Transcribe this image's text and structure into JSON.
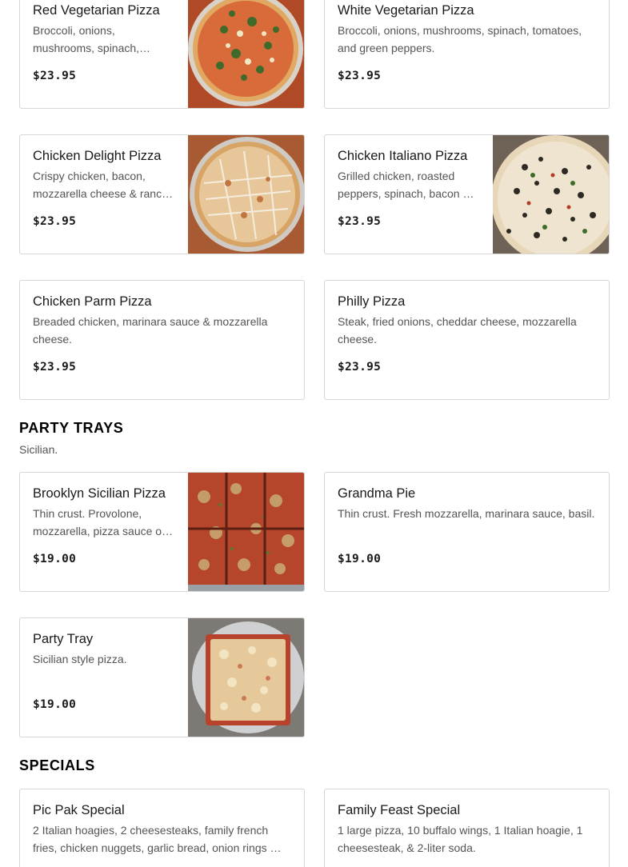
{
  "cards": [
    {
      "name": "Red Vegetarian Pizza",
      "desc": "Broccoli, onions, mushrooms, spinach,…",
      "price": "$23.95"
    },
    {
      "name": "White Vegetarian Pizza",
      "desc": "Broccoli, onions, mushrooms, spinach, tomatoes, and green peppers.",
      "price": "$23.95"
    },
    {
      "name": "Chicken Delight Pizza",
      "desc": "Crispy chicken, bacon, mozzarella cheese & ranc…",
      "price": "$23.95"
    },
    {
      "name": "Chicken Italiano Pizza",
      "desc": "Grilled chicken, roasted peppers, spinach, bacon …",
      "price": "$23.95"
    },
    {
      "name": "Chicken Parm Pizza",
      "desc": "Breaded chicken, marinara sauce & mozzarella cheese.",
      "price": "$23.95"
    },
    {
      "name": "Philly Pizza",
      "desc": "Steak, fried onions, cheddar cheese, mozzarella cheese.",
      "price": "$23.95"
    },
    {
      "name": "Brooklyn Sicilian Pizza",
      "desc": "Thin crust. Provolone, mozzarella, pizza sauce o…",
      "price": "$19.00"
    },
    {
      "name": "Grandma Pie",
      "desc": "Thin crust. Fresh mozzarella, marinara sauce, basil.",
      "price": "$19.00"
    },
    {
      "name": "Party Tray",
      "desc": "Sicilian style pizza.",
      "price": "$19.00"
    },
    {
      "name": "Pic Pak Special",
      "desc": "2 Italian hoagies, 2 cheesesteaks, family french fries, chicken nuggets, garlic bread, onion rings …",
      "price": ""
    },
    {
      "name": "Family Feast Special",
      "desc": "1 large pizza, 10 buffalo wings, 1 Italian hoagie, 1 cheesesteak, & 2-liter soda.",
      "price": ""
    }
  ],
  "sections": {
    "party_trays": {
      "title": "PARTY TRAYS",
      "subtitle": "Sicilian."
    },
    "specials": {
      "title": "SPECIALS"
    }
  }
}
